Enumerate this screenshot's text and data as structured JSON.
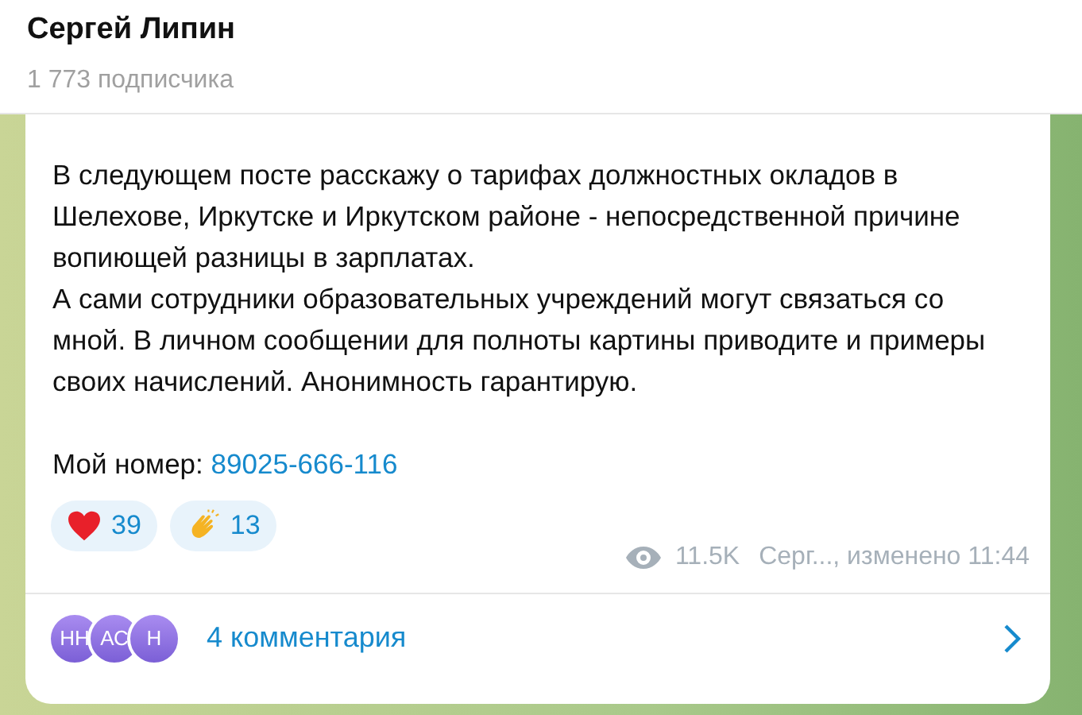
{
  "header": {
    "title": "Сергей Липин",
    "subtitle": "1 773 подписчика"
  },
  "message": {
    "paragraphs": [
      "В следующем посте расскажу о тарифах должностных окладов в Шелехове, Иркутске и Иркутском районе - непосредственной причине вопиющей разницы в зарплатах.",
      "А сами сотрудники образовательных учреждений могут связаться со мной. В личном сообщении для полноты картины приводите и примеры своих начислений. Анонимность гарантирую."
    ],
    "phone_label": "Мой номер:",
    "phone": "89025-666-116",
    "reactions": [
      {
        "kind": "heart",
        "count": "39"
      },
      {
        "kind": "clap",
        "count": "13"
      }
    ],
    "views": "11.5K",
    "meta": "Серг..., изменено 11:44"
  },
  "comments": {
    "avatars": [
      "НН",
      "АС",
      "Н"
    ],
    "label": "4 комментария"
  }
}
